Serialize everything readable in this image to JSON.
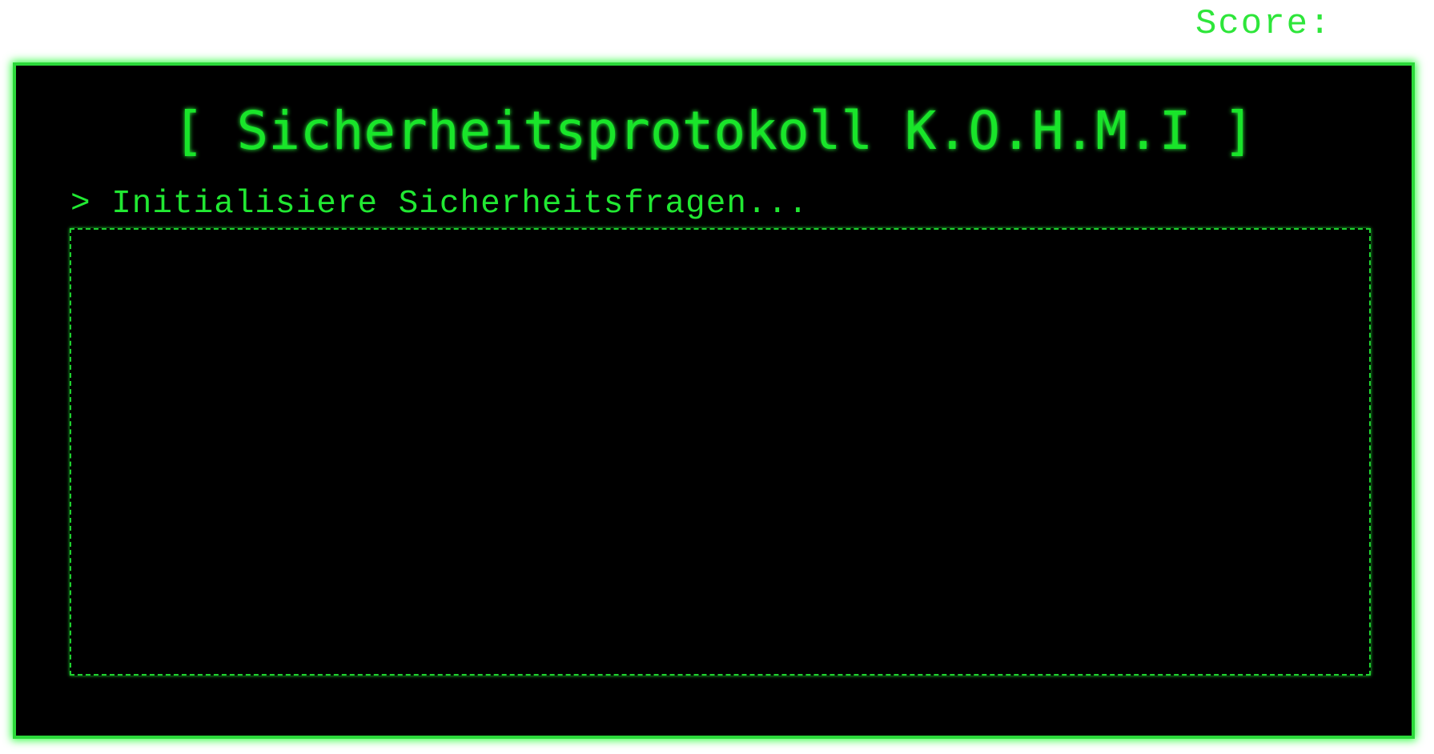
{
  "header": {
    "score_label": "Score:"
  },
  "terminal": {
    "title": "[ Sicherheitsprotokoll K.O.H.M.I ]",
    "status_line": "> Initialisiere Sicherheitsfragen...",
    "accent_color": "#2bd93a",
    "background_color": "#000000"
  }
}
